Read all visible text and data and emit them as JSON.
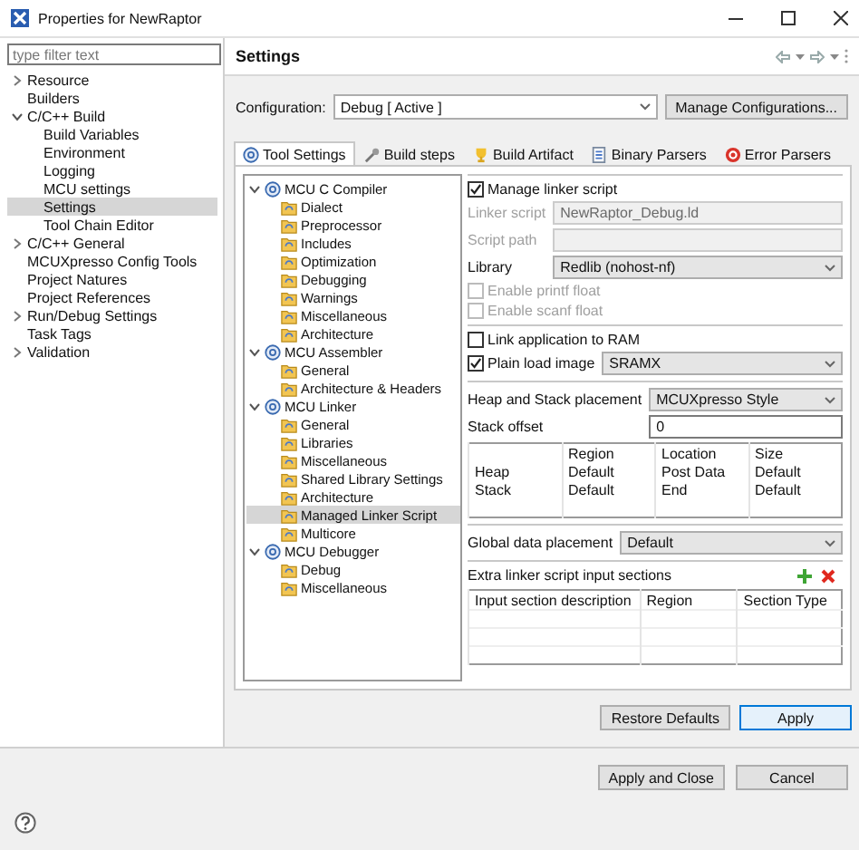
{
  "window": {
    "title": "Properties for NewRaptor"
  },
  "filter": {
    "placeholder": "type filter text"
  },
  "nav": [
    {
      "label": "Resource",
      "expanded": false,
      "selected": false
    },
    {
      "label": "Builders",
      "selected": false
    },
    {
      "label": "C/C++ Build",
      "expanded": true,
      "selected": false,
      "children": [
        {
          "label": "Build Variables",
          "selected": false
        },
        {
          "label": "Environment",
          "selected": false
        },
        {
          "label": "Logging",
          "selected": false
        },
        {
          "label": "MCU settings",
          "selected": false
        },
        {
          "label": "Settings",
          "selected": true
        },
        {
          "label": "Tool Chain Editor",
          "selected": false
        }
      ]
    },
    {
      "label": "C/C++ General",
      "expanded": false,
      "selected": false
    },
    {
      "label": "MCUXpresso Config Tools",
      "selected": false
    },
    {
      "label": "Project Natures",
      "selected": false
    },
    {
      "label": "Project References",
      "selected": false
    },
    {
      "label": "Run/Debug Settings",
      "expanded": false,
      "selected": false
    },
    {
      "label": "Task Tags",
      "selected": false
    },
    {
      "label": "Validation",
      "expanded": false,
      "selected": false
    }
  ],
  "page": {
    "title": "Settings"
  },
  "configuration": {
    "label": "Configuration:",
    "value": "Debug  [ Active ]",
    "button": "Manage Configurations..."
  },
  "tabs": [
    {
      "label": "Tool Settings",
      "kind": "gear",
      "selected": true
    },
    {
      "label": "Build steps",
      "kind": "wrench",
      "selected": false
    },
    {
      "label": "Build Artifact",
      "kind": "trophy",
      "selected": false
    },
    {
      "label": "Binary Parsers",
      "kind": "binary",
      "selected": false
    },
    {
      "label": "Error Parsers",
      "kind": "error",
      "selected": false
    }
  ],
  "tool_tree": [
    {
      "label": "MCU C Compiler",
      "expanded": true,
      "selected": false,
      "children": [
        {
          "label": "Dialect",
          "selected": false
        },
        {
          "label": "Preprocessor",
          "selected": false
        },
        {
          "label": "Includes",
          "selected": false
        },
        {
          "label": "Optimization",
          "selected": false
        },
        {
          "label": "Debugging",
          "selected": false
        },
        {
          "label": "Warnings",
          "selected": false
        },
        {
          "label": "Miscellaneous",
          "selected": false
        },
        {
          "label": "Architecture",
          "selected": false
        }
      ]
    },
    {
      "label": "MCU Assembler",
      "expanded": true,
      "selected": false,
      "children": [
        {
          "label": "General",
          "selected": false
        },
        {
          "label": "Architecture & Headers",
          "selected": false
        }
      ]
    },
    {
      "label": "MCU Linker",
      "expanded": true,
      "selected": false,
      "children": [
        {
          "label": "General",
          "selected": false
        },
        {
          "label": "Libraries",
          "selected": false
        },
        {
          "label": "Miscellaneous",
          "selected": false
        },
        {
          "label": "Shared Library Settings",
          "selected": false
        },
        {
          "label": "Architecture",
          "selected": false
        },
        {
          "label": "Managed Linker Script",
          "selected": true
        },
        {
          "label": "Multicore",
          "selected": false
        }
      ]
    },
    {
      "label": "MCU Debugger",
      "expanded": true,
      "selected": false,
      "children": [
        {
          "label": "Debug",
          "selected": false
        },
        {
          "label": "Miscellaneous",
          "selected": false
        }
      ]
    }
  ],
  "linker_options": {
    "groups": [
      [
        {
          "kind": "checkbox",
          "label": "Manage linker script",
          "checked": true,
          "disabled": false
        },
        {
          "kind": "field",
          "label": "Linker script",
          "value": "NewRaptor_Debug.ld",
          "disabled": true
        },
        {
          "kind": "field",
          "label": "Script path",
          "disabled": true
        },
        {
          "kind": "select",
          "label": "Library",
          "value": "Redlib (nohost-nf)"
        },
        {
          "kind": "checkbox",
          "label": "Enable printf float",
          "checked": false,
          "disabled": true
        },
        {
          "kind": "checkbox",
          "label": "Enable scanf float",
          "checked": false,
          "disabled": true
        }
      ],
      [
        {
          "kind": "checkbox",
          "label": "Link application to RAM",
          "checked": false,
          "disabled": false
        },
        {
          "kind": "checkbox-select",
          "label": "Plain load image",
          "checked": true,
          "disabled": false,
          "value": "SRAMX"
        }
      ],
      [
        {
          "kind": "select",
          "label": "Heap and Stack placement",
          "value": "MCUXpresso Style"
        },
        {
          "kind": "field",
          "label": "Stack offset",
          "value": "0",
          "disabled": false
        },
        {
          "kind": "table",
          "columns": [
            "Region",
            "Location",
            "Size"
          ],
          "rows": [
            {
              "name": "Heap",
              "cells": [
                "Default",
                "Post Data",
                "Default"
              ]
            },
            {
              "name": "Stack",
              "cells": [
                "Default",
                "End",
                "Default"
              ]
            }
          ]
        }
      ],
      [
        {
          "kind": "select",
          "label": "Global data placement",
          "value": "Default"
        }
      ]
    ]
  },
  "input_sections": {
    "label": "Extra linker script input sections",
    "columns": [
      "Input section description",
      "Region",
      "Section Type"
    ]
  },
  "buttons": [
    {
      "label": "Restore Defaults",
      "focused": false
    },
    {
      "label": "Apply",
      "focused": true
    }
  ],
  "dialog_buttons": [
    {
      "label": "Apply and Close"
    },
    {
      "label": "Cancel"
    }
  ]
}
